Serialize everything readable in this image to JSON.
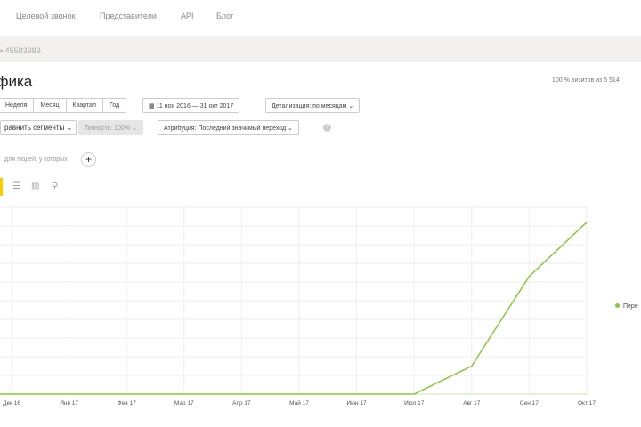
{
  "topnav": {
    "items": [
      "Целевой звонок",
      "Представители",
      "API",
      "Блог"
    ]
  },
  "breadcrumb": {
    "counter": "•  45583989"
  },
  "page": {
    "title": "афика",
    "sample_info": "100 % визитов из 5 514"
  },
  "periods": [
    "Неделя",
    "Месяц",
    "Квартал",
    "Год"
  ],
  "date_range": "11 ноя 2016 — 31 окт 2017",
  "detail": "Детализация: по месяцам",
  "compare": "равнить сегменты",
  "accuracy": "Точность: 100%",
  "attribution": "Атрибуция: Последний значимый переход",
  "segment_text": "для людей, у которых",
  "chart_data": {
    "type": "line",
    "categories": [
      "Дек 16",
      "Янв 17",
      "Фев 17",
      "Мар 17",
      "Апр 17",
      "Май 17",
      "Июн 17",
      "Июл 17",
      "Авг 17",
      "Сен 17",
      "Окт 17"
    ],
    "series": [
      {
        "name": "Пере",
        "values": [
          0,
          0,
          0,
          0,
          0,
          0,
          0,
          0,
          15,
          63,
          92
        ]
      }
    ],
    "ylim": [
      0,
      100
    ],
    "color": "#8dc63f",
    "grid": true,
    "legend": "right"
  }
}
